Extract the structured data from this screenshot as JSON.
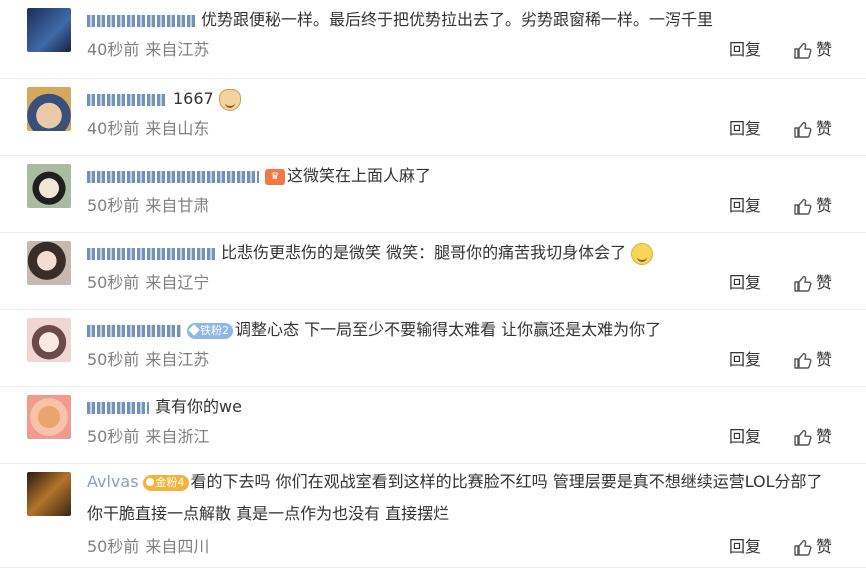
{
  "ui": {
    "reply_label": "回复",
    "like_label": "赞"
  },
  "comments": [
    {
      "text": "优势跟便秘一样。最后终于把优势拉出去了。劣势跟窗稀一样。一泻千里",
      "time": "40秒前",
      "source": "来自江苏",
      "avatar_color": "#2a3c6b"
    },
    {
      "text": "1667",
      "time": "40秒前",
      "source": "来自山东",
      "avatar_color": "#d7b98c"
    },
    {
      "text": "这微笑在上面人麻了",
      "time": "50秒前",
      "source": "来自甘肃",
      "avatar_color": "#9fb3a0"
    },
    {
      "text": "比悲伤更悲伤的是微笑 微笑：腿哥你的痛苦我切身体会了",
      "time": "50秒前",
      "source": "来自辽宁",
      "avatar_color": "#8c7a70"
    },
    {
      "text": "调整心态 下一局至少不要输得太难看 让你赢还是太难为你了",
      "badge": "铁粉2",
      "time": "50秒前",
      "source": "来自江苏",
      "avatar_color": "#e8c9c4"
    },
    {
      "text": "真有你的we",
      "time": "50秒前",
      "source": "来自浙江",
      "avatar_color": "#f2b08a"
    },
    {
      "text": "看的下去吗 你们在观战室看到这样的比赛脸不红吗 管理层要是真不想继续运营LOL分部了 你干脆直接一点解散 真是一点作为也没有 直接摆烂",
      "badge": "金粉4",
      "username_text": "Avlvas",
      "time": "50秒前",
      "source": "来自四川",
      "avatar_color": "#5a3a1e"
    }
  ]
}
